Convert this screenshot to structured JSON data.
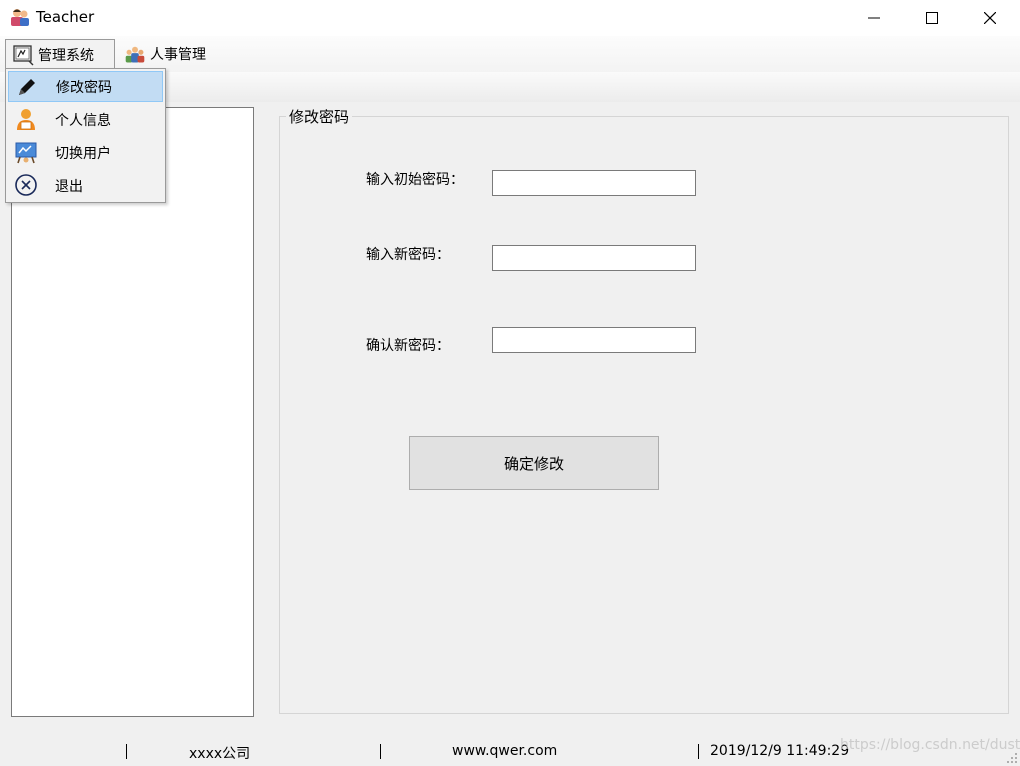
{
  "window": {
    "title": "Teacher"
  },
  "menubar": {
    "items": [
      {
        "label": "管理系统",
        "icon": "admin-system-icon"
      },
      {
        "label": "人事管理",
        "icon": "personnel-icon"
      }
    ]
  },
  "dropdown": {
    "items": [
      {
        "label": "修改密码",
        "icon": "pencil-icon",
        "highlighted": true
      },
      {
        "label": "个人信息",
        "icon": "person-icon"
      },
      {
        "label": "切换用户",
        "icon": "switch-user-icon"
      },
      {
        "label": "退出",
        "icon": "exit-icon"
      }
    ]
  },
  "form": {
    "group_title": "修改密码",
    "old_password_label": "输入初始密码：",
    "old_password_value": "",
    "new_password_label": "输入新密码：",
    "new_password_value": "",
    "confirm_password_label": "确认新密码：",
    "confirm_password_value": "",
    "submit_label": "确定修改"
  },
  "statusbar": {
    "company": "xxxx公司",
    "website": "www.qwer.com",
    "datetime": "2019/12/9 11:49:29"
  },
  "watermark": "https://blog.csdn.net/dust_",
  "colors": {
    "menu_highlight": "#c2dcf3",
    "background": "#f0f0f0"
  }
}
